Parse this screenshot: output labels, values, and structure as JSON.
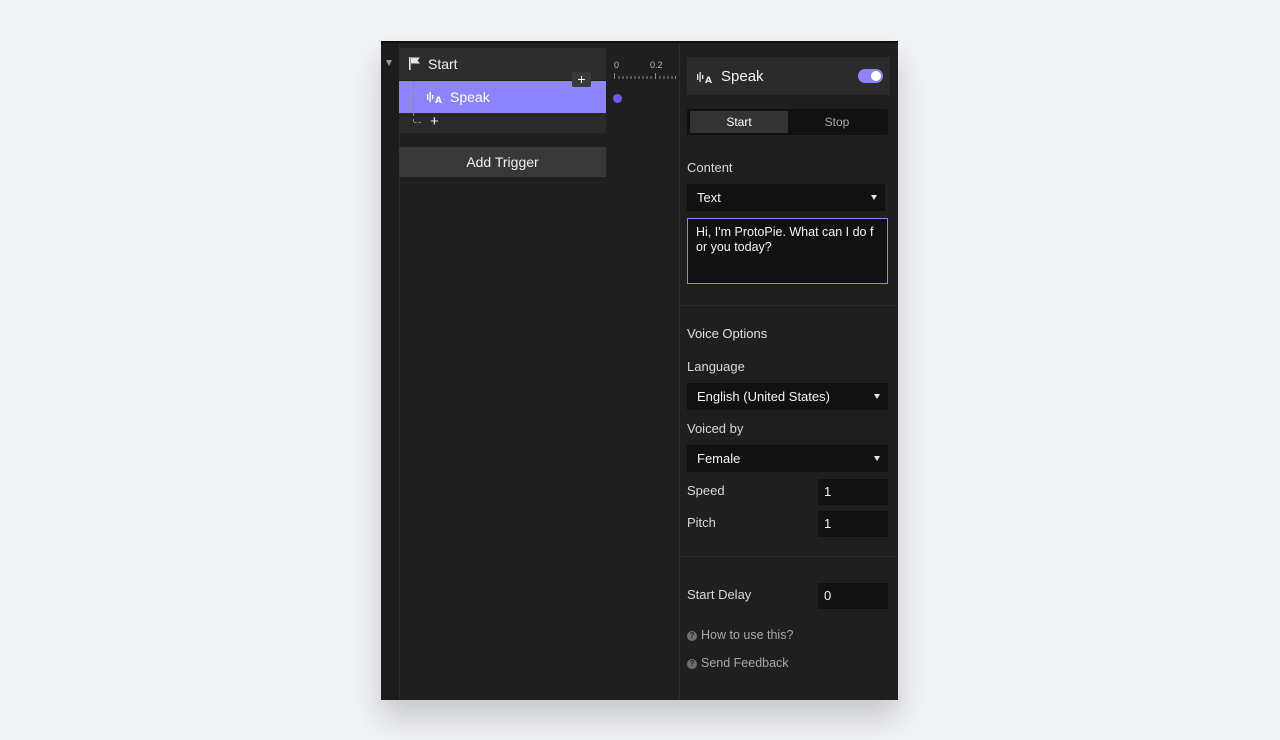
{
  "timeline": {
    "panel": {
      "trigger_label": "Start",
      "response_label": "Speak",
      "add_response_plus": "+",
      "add_small_plus": "+",
      "add_trigger_label": "Add Trigger"
    },
    "ruler": {
      "tick_labels": [
        "0",
        "0.2"
      ]
    }
  },
  "properties": {
    "header": {
      "title": "Speak",
      "enabled": true
    },
    "tabs": {
      "start": "Start",
      "stop": "Stop",
      "active": "Start"
    },
    "content": {
      "label": "Content",
      "type_selected": "Text",
      "text_value": "Hi, I'm ProtoPie. What can I do for you today?"
    },
    "voice_options": {
      "section_label": "Voice Options",
      "language_label": "Language",
      "language_selected": "English (United States)",
      "voiced_by_label": "Voiced by",
      "voiced_by_selected": "Female",
      "speed_label": "Speed",
      "speed_value": "1",
      "pitch_label": "Pitch",
      "pitch_value": "1"
    },
    "delay": {
      "label": "Start Delay",
      "value": "0"
    },
    "links": {
      "help": "How to use this?",
      "feedback": "Send Feedback",
      "help_icon_glyph": "?"
    }
  },
  "colors": {
    "accent": "#8e84ff",
    "keyframe": "#6b5ee8",
    "panel_bg": "#1f1f1f",
    "input_bg": "#111111"
  },
  "icons": {
    "trigger": "flag-icon",
    "response": "speak-waveform-icon",
    "dropdown": "caret-down-icon",
    "help": "question-circle-icon"
  }
}
